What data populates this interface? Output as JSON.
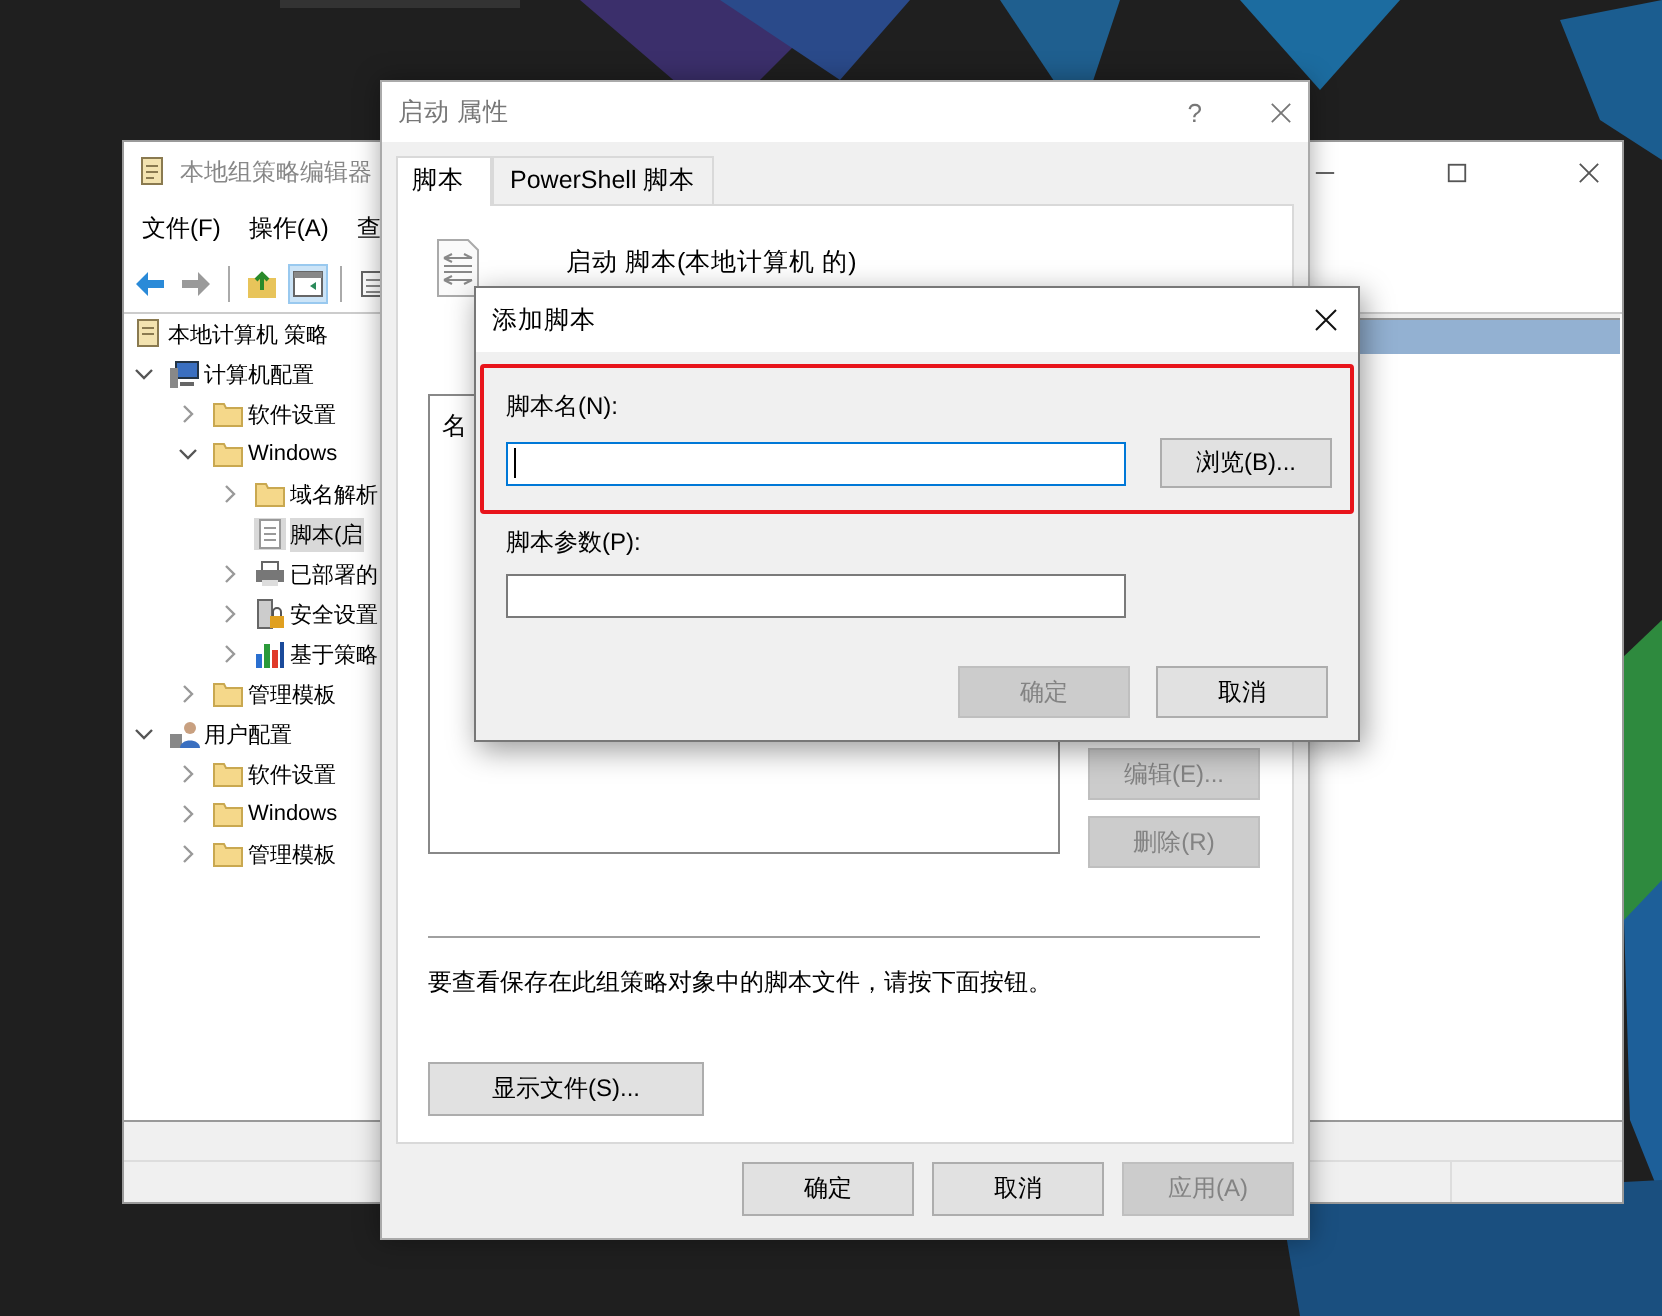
{
  "gp_editor": {
    "title": "本地组策略编辑器",
    "menu": [
      "文件(F)",
      "操作(A)",
      "查"
    ],
    "toolbar": [
      {
        "kind": "back",
        "selected": false
      },
      {
        "kind": "forward",
        "selected": false
      },
      {
        "kind": "up",
        "selected": false
      },
      {
        "kind": "tree",
        "selected": true
      },
      {
        "kind": "sheet",
        "selected": false
      }
    ],
    "tree": [
      {
        "label": "本地计算机 策略",
        "kind": "policy",
        "selected": false,
        "children": [
          {
            "label": "计算机配置",
            "kind": "computer",
            "expanded": true,
            "selected": false,
            "children": [
              {
                "label": "软件设置",
                "kind": "folder",
                "expanded": false,
                "selected": false
              },
              {
                "label": "Windows",
                "kind": "folder",
                "expanded": true,
                "selected": false,
                "children": [
                  {
                    "label": "域名解析",
                    "kind": "folder",
                    "expanded": false,
                    "selected": false
                  },
                  {
                    "label": "脚本(启",
                    "kind": "script",
                    "selected": true
                  },
                  {
                    "label": "已部署的",
                    "kind": "printer",
                    "expanded": false,
                    "selected": false
                  },
                  {
                    "label": "安全设置",
                    "kind": "security",
                    "expanded": false,
                    "selected": false
                  },
                  {
                    "label": "基于策略",
                    "kind": "chart",
                    "expanded": false,
                    "selected": false
                  }
                ]
              },
              {
                "label": "管理模板",
                "kind": "folder",
                "expanded": false,
                "selected": false
              }
            ]
          },
          {
            "label": "用户配置",
            "kind": "user",
            "expanded": true,
            "selected": false,
            "children": [
              {
                "label": "软件设置",
                "kind": "folder",
                "expanded": false,
                "selected": false
              },
              {
                "label": "Windows",
                "kind": "folder",
                "expanded": false,
                "selected": false
              },
              {
                "label": "管理模板",
                "kind": "folder",
                "expanded": false,
                "selected": false
              }
            ]
          }
        ]
      }
    ],
    "list_rows": [
      {
        "selected": true
      }
    ]
  },
  "properties_dialog": {
    "title": "启动 属性",
    "help": "?",
    "tabs": [
      {
        "label": "脚本",
        "selected": true
      },
      {
        "label": "PowerShell 脚本",
        "selected": false
      }
    ],
    "heading": "启动 脚本(本地计算机 的)",
    "list_column": "名",
    "side_buttons": [
      {
        "label": "编辑(E)...",
        "disabled": true
      },
      {
        "label": "删除(R)",
        "disabled": true
      }
    ],
    "hint": "要查看保存在此组策略对象中的脚本文件，请按下面按钮。",
    "show_files_button": "显示文件(S)...",
    "buttons": [
      {
        "label": "确定",
        "disabled": false
      },
      {
        "label": "取消",
        "disabled": false
      },
      {
        "label": "应用(A)",
        "disabled": true
      }
    ]
  },
  "add_script_dialog": {
    "title": "添加脚本",
    "name_field": {
      "label": "脚本名(N):",
      "focused": true,
      "highlighted": true
    },
    "browse_button": "浏览(B)...",
    "params_field": {
      "label": "脚本参数(P):",
      "focused": false
    },
    "buttons": [
      {
        "label": "确定",
        "disabled": true
      },
      {
        "label": "取消",
        "disabled": false
      }
    ]
  }
}
